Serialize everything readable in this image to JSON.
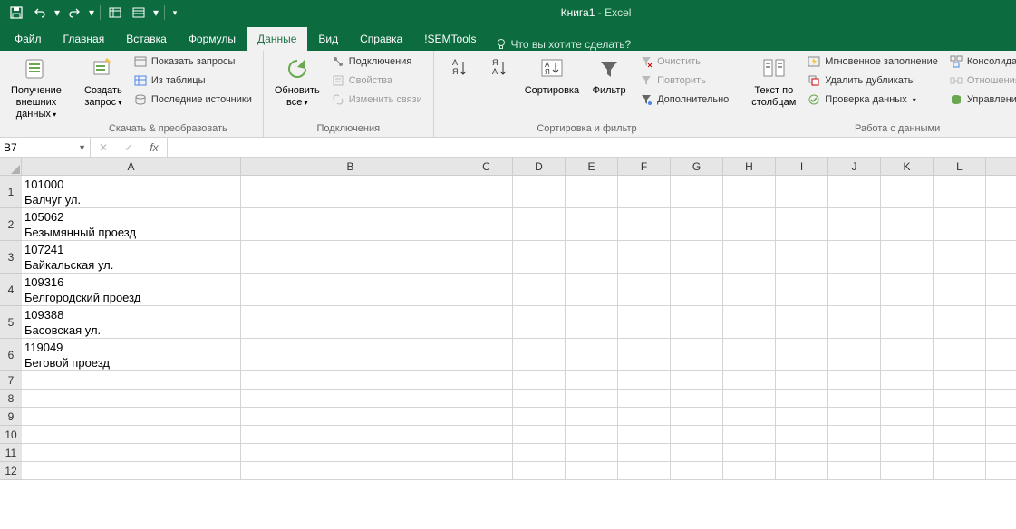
{
  "title": {
    "book": "Книга1",
    "app": "Excel"
  },
  "tabs": [
    "Файл",
    "Главная",
    "Вставка",
    "Формулы",
    "Данные",
    "Вид",
    "Справка",
    "!SEMTools"
  ],
  "active_tab": "Данные",
  "tell_me": "Что вы хотите сделать?",
  "ribbon": {
    "g1": {
      "label": "",
      "btn1": "Получение\nвнешних данных"
    },
    "g2": {
      "label": "Скачать & преобразовать",
      "btn1": "Создать\nзапрос",
      "s1": "Показать запросы",
      "s2": "Из таблицы",
      "s3": "Последние источники"
    },
    "g3": {
      "label": "Подключения",
      "btn1": "Обновить\nвсе",
      "s1": "Подключения",
      "s2": "Свойства",
      "s3": "Изменить связи"
    },
    "g4": {
      "label": "Сортировка и фильтр",
      "btn1": "Сортировка",
      "btn2": "Фильтр",
      "s1": "Очистить",
      "s2": "Повторить",
      "s3": "Дополнительно"
    },
    "g5": {
      "label": "Работа с данными",
      "btn1": "Текст по\nстолбцам",
      "s1": "Мгновенное заполнение",
      "s2": "Удалить дубликаты",
      "s3": "Проверка данных",
      "s4": "Консолидация",
      "s5": "Отношения",
      "s6": "Управление мод"
    }
  },
  "namebox": "B7",
  "formula": "",
  "columns": [
    "A",
    "B",
    "C",
    "D",
    "E",
    "F",
    "G",
    "H",
    "I",
    "J",
    "K",
    "L"
  ],
  "rows": [
    {
      "n": 1,
      "a": "101000\nБалчуг ул."
    },
    {
      "n": 2,
      "a": "105062\nБезымянный проезд"
    },
    {
      "n": 3,
      "a": "107241\nБайкальская ул."
    },
    {
      "n": 4,
      "a": "109316\nБелгородский проезд"
    },
    {
      "n": 5,
      "a": "109388\nБасовская ул."
    },
    {
      "n": 6,
      "a": "119049\nБеговой проезд"
    },
    {
      "n": 7,
      "a": ""
    },
    {
      "n": 8,
      "a": ""
    },
    {
      "n": 9,
      "a": ""
    },
    {
      "n": 10,
      "a": ""
    },
    {
      "n": 11,
      "a": ""
    },
    {
      "n": 12,
      "a": ""
    }
  ]
}
